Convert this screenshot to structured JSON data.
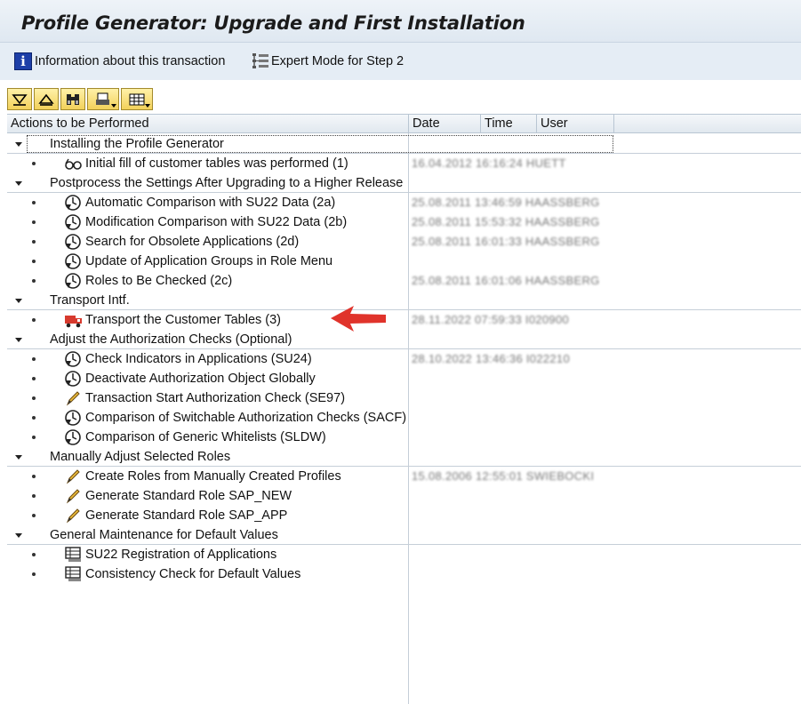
{
  "window": {
    "title": "Profile Generator: Upgrade and First Installation"
  },
  "toolbar": {
    "info_label": "Information about this transaction",
    "expert_label": "Expert Mode for Step 2"
  },
  "tree_toolbar": [
    "expand-all",
    "collapse-all",
    "find",
    "print",
    "layout"
  ],
  "columns": {
    "actions": "Actions to be Performed",
    "date": "Date",
    "time": "Time",
    "user": "User"
  },
  "sections": [
    {
      "label": "Installing the Profile Generator",
      "items": [
        {
          "label": "Initial fill of customer tables was performed (1)",
          "icon": "glasses-icon",
          "log": "16.04.2012 16:16:24 HUETT"
        }
      ]
    },
    {
      "label": "Postprocess the Settings After Upgrading to a Higher Release",
      "items": [
        {
          "label": "Automatic Comparison with SU22 Data (2a)",
          "icon": "clock-execute-icon",
          "log": "25.08.2011 13:46:59 HAASSBERG"
        },
        {
          "label": "Modification Comparison with SU22 Data (2b)",
          "icon": "clock-execute-icon",
          "log": "25.08.2011 15:53:32 HAASSBERG"
        },
        {
          "label": "Search for Obsolete Applications (2d)",
          "icon": "clock-execute-icon",
          "log": "25.08.2011 16:01:33 HAASSBERG"
        },
        {
          "label": "Update of Application Groups in Role Menu",
          "icon": "clock-execute-icon",
          "log": ""
        },
        {
          "label": "Roles to Be Checked (2c)",
          "icon": "clock-execute-icon",
          "log": "25.08.2011 16:01:06 HAASSBERG"
        }
      ]
    },
    {
      "label": "Transport Intf.",
      "items": [
        {
          "label": "Transport the Customer Tables (3)",
          "icon": "truck-icon",
          "log": "28.11.2022 07:59:33 I020900"
        }
      ]
    },
    {
      "label": "Adjust the Authorization Checks (Optional)",
      "items": [
        {
          "label": "Check Indicators in Applications (SU24)",
          "icon": "clock-execute-icon",
          "log": "28.10.2022 13:46:36 I022210"
        },
        {
          "label": "Deactivate Authorization Object Globally",
          "icon": "clock-execute-icon",
          "log": ""
        },
        {
          "label": "Transaction Start Authorization Check (SE97)",
          "icon": "pencil-icon",
          "log": ""
        },
        {
          "label": "Comparison of Switchable Authorization Checks (SACF)",
          "icon": "clock-execute-icon",
          "log": ""
        },
        {
          "label": "Comparison of Generic Whitelists (SLDW)",
          "icon": "clock-execute-icon",
          "log": ""
        }
      ]
    },
    {
      "label": "Manually Adjust Selected Roles",
      "items": [
        {
          "label": "Create Roles from Manually Created Profiles",
          "icon": "pencil-icon",
          "log": "15.08.2006 12:55:01 SWIEBOCKI"
        },
        {
          "label": "Generate Standard Role SAP_NEW",
          "icon": "pencil-icon",
          "log": ""
        },
        {
          "label": "Generate Standard Role SAP_APP",
          "icon": "pencil-icon",
          "log": ""
        }
      ]
    },
    {
      "label": "General Maintenance for Default Values",
      "items": [
        {
          "label": "SU22 Registration of Applications",
          "icon": "table-icon",
          "log": ""
        },
        {
          "label": "Consistency Check for Default Values",
          "icon": "table-icon",
          "log": ""
        }
      ]
    }
  ],
  "highlight": {
    "item": "Transport the Customer Tables (3)",
    "annotation": "red-arrow-icon",
    "color": "#e0332b"
  },
  "colors": {
    "title_bg": "#e5edf5",
    "button_yellow": "#f2d15a",
    "grid_line": "#c5ced8"
  }
}
